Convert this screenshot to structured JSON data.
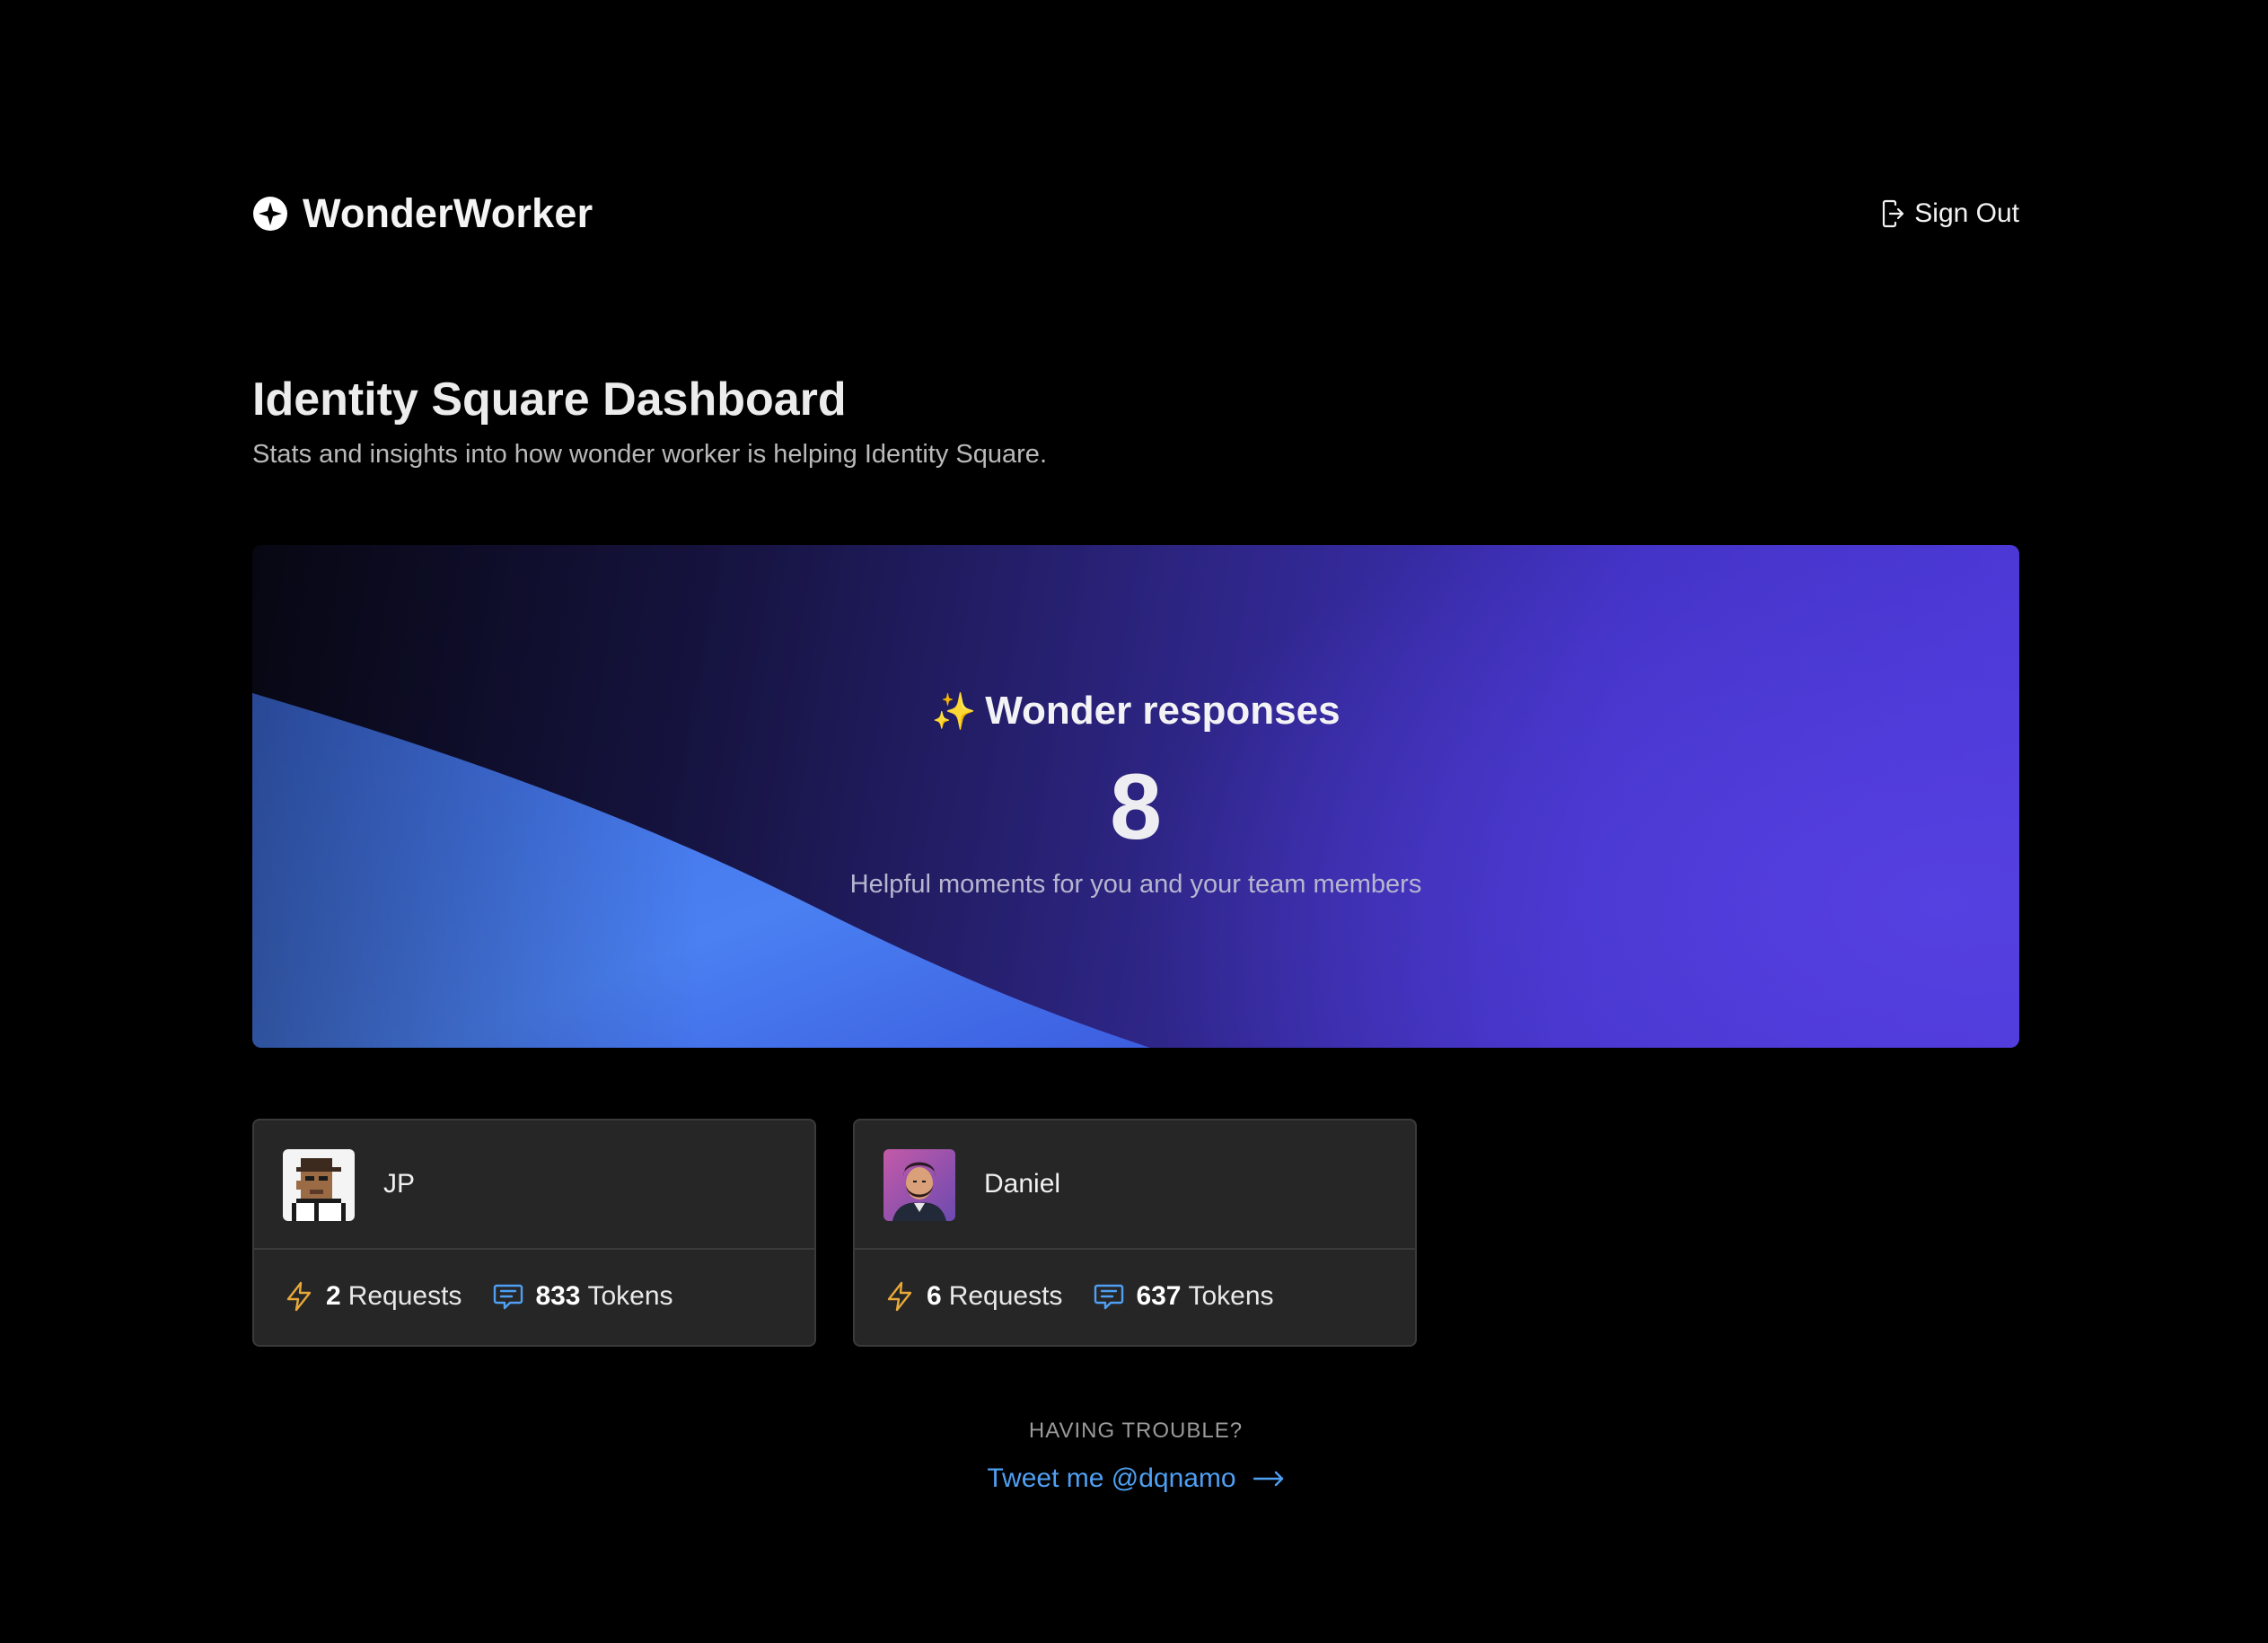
{
  "header": {
    "app_name": "WonderWorker",
    "logo_icon": "wonderworker-logo-icon",
    "signout_label": "Sign Out",
    "signout_icon": "sign-out-icon"
  },
  "page": {
    "title": "Identity Square Dashboard",
    "subtitle": "Stats and insights into how wonder worker is helping Identity Square."
  },
  "hero": {
    "sparkle": "✨",
    "heading": "Wonder responses",
    "value": "8",
    "caption": "Helpful moments for you and your team members",
    "colors": {
      "start": "#070712",
      "end": "#4a37d6",
      "wave": "#4a7ef0"
    }
  },
  "members": [
    {
      "name": "JP",
      "avatar": "pixel-art-avatar",
      "requests": "2",
      "requests_label": "Requests",
      "tokens": "833",
      "tokens_label": "Tokens"
    },
    {
      "name": "Daniel",
      "avatar": "portrait-avatar",
      "requests": "6",
      "requests_label": "Requests",
      "tokens": "637",
      "tokens_label": "Tokens"
    }
  ],
  "icons": {
    "requests": "lightning-icon",
    "tokens": "chat-bubble-icon",
    "arrow": "arrow-right-icon"
  },
  "colors": {
    "lightning": "#e8a93a",
    "chat": "#4f9ff2",
    "link": "#4f9ff2"
  },
  "footer": {
    "trouble_label": "HAVING TROUBLE?",
    "tweet_label": "Tweet me @dqnamo"
  }
}
